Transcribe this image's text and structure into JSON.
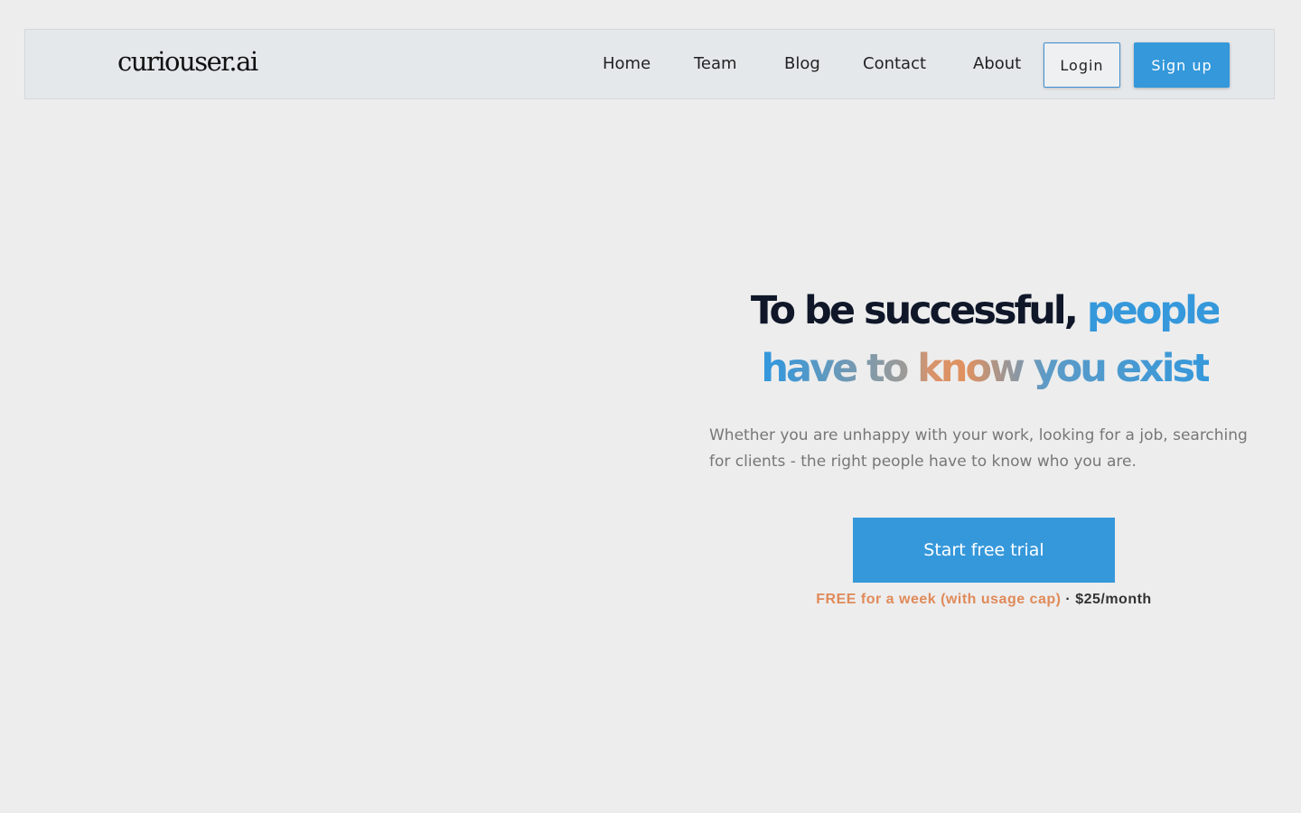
{
  "header": {
    "logo": "curiouser.ai",
    "nav": [
      {
        "label": "Home"
      },
      {
        "label": "Team"
      },
      {
        "label": "Blog"
      },
      {
        "label": "Contact"
      },
      {
        "label": "About"
      }
    ],
    "login_label": "Login",
    "signup_label": "Sign up"
  },
  "hero": {
    "headline_plain": "To be successful,",
    "headline_gradient": "people have to know you exist",
    "subtitle": "Whether you are unhappy with your work, looking for a job, searching for clients - the right people have to know who you are.",
    "cta_label": "Start free trial",
    "pricing_free": "FREE for a week (with usage cap)",
    "pricing_separator": "·",
    "pricing_price": "$25/month"
  },
  "colors": {
    "accent": "#3498db",
    "warm_accent": "#e08a5a",
    "headline": "#0f1729"
  }
}
